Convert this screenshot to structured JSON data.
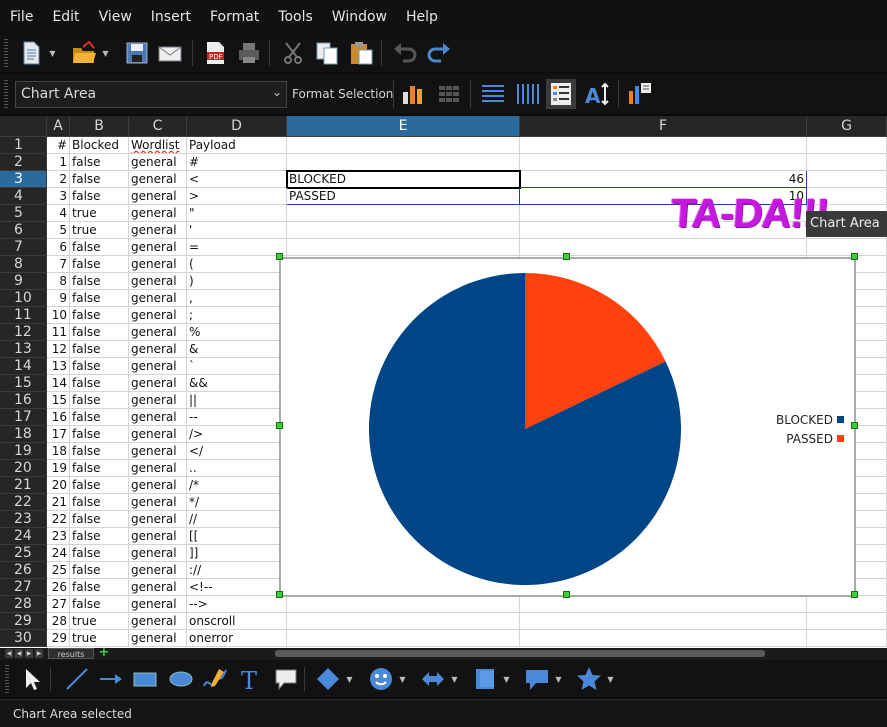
{
  "menubar": {
    "items": [
      "File",
      "Edit",
      "View",
      "Insert",
      "Format",
      "Tools",
      "Window",
      "Help"
    ]
  },
  "toolbar_standard": {
    "buttons": [
      {
        "name": "new-document-icon",
        "dropdown": true
      },
      {
        "name": "open-folder-icon",
        "dropdown": true
      },
      {
        "name": "save-icon"
      },
      {
        "name": "email-icon"
      },
      {
        "name": "export-pdf-icon"
      },
      {
        "name": "print-icon"
      },
      {
        "name": "cut-icon"
      },
      {
        "name": "copy-icon"
      },
      {
        "name": "paste-icon"
      },
      {
        "name": "undo-icon"
      },
      {
        "name": "redo-icon"
      }
    ]
  },
  "toolbar_chart": {
    "element_select": {
      "value": "Chart Area"
    },
    "format_selection_label": "Format Selection",
    "buttons": [
      {
        "name": "chart-type-icon"
      },
      {
        "name": "data-table-icon"
      },
      {
        "name": "horizontal-grids-icon"
      },
      {
        "name": "vertical-grids-icon"
      },
      {
        "name": "legend-on-off-icon"
      },
      {
        "name": "scale-text-icon"
      },
      {
        "name": "automatic-layout-icon"
      }
    ]
  },
  "sheet": {
    "columns": [
      "A",
      "B",
      "C",
      "D",
      "E",
      "F",
      "G"
    ],
    "selected_column": "E",
    "selected_row": "3",
    "header_row": {
      "A": "#",
      "B": "Blocked",
      "C": "Wordlist",
      "D": "Payload"
    },
    "rows": [
      {
        "A": "1",
        "B": "false",
        "C": "general",
        "D": "#"
      },
      {
        "A": "2",
        "B": "false",
        "C": "general",
        "D": "<"
      },
      {
        "A": "3",
        "B": "false",
        "C": "general",
        "D": ">"
      },
      {
        "A": "4",
        "B": "true",
        "C": "general",
        "D": "\""
      },
      {
        "A": "5",
        "B": "true",
        "C": "general",
        "D": "'"
      },
      {
        "A": "6",
        "B": "false",
        "C": "general",
        "D": "="
      },
      {
        "A": "7",
        "B": "false",
        "C": "general",
        "D": "("
      },
      {
        "A": "8",
        "B": "false",
        "C": "general",
        "D": ")"
      },
      {
        "A": "9",
        "B": "false",
        "C": "general",
        "D": ","
      },
      {
        "A": "10",
        "B": "false",
        "C": "general",
        "D": ";"
      },
      {
        "A": "11",
        "B": "false",
        "C": "general",
        "D": "%"
      },
      {
        "A": "12",
        "B": "false",
        "C": "general",
        "D": "&"
      },
      {
        "A": "13",
        "B": "false",
        "C": "general",
        "D": "`"
      },
      {
        "A": "14",
        "B": "false",
        "C": "general",
        "D": "&&"
      },
      {
        "A": "15",
        "B": "false",
        "C": "general",
        "D": "||"
      },
      {
        "A": "16",
        "B": "false",
        "C": "general",
        "D": "--"
      },
      {
        "A": "17",
        "B": "false",
        "C": "general",
        "D": "/>"
      },
      {
        "A": "18",
        "B": "false",
        "C": "general",
        "D": "</"
      },
      {
        "A": "19",
        "B": "false",
        "C": "general",
        "D": ".."
      },
      {
        "A": "20",
        "B": "false",
        "C": "general",
        "D": "/*"
      },
      {
        "A": "21",
        "B": "false",
        "C": "general",
        "D": "*/"
      },
      {
        "A": "22",
        "B": "false",
        "C": "general",
        "D": "//"
      },
      {
        "A": "23",
        "B": "false",
        "C": "general",
        "D": "[["
      },
      {
        "A": "24",
        "B": "false",
        "C": "general",
        "D": "]]"
      },
      {
        "A": "25",
        "B": "false",
        "C": "general",
        "D": "://"
      },
      {
        "A": "26",
        "B": "false",
        "C": "general",
        "D": "<!--"
      },
      {
        "A": "27",
        "B": "false",
        "C": "general",
        "D": "-->"
      },
      {
        "A": "28",
        "B": "true",
        "C": "general",
        "D": "onscroll"
      },
      {
        "A": "29",
        "B": "true",
        "C": "general",
        "D": "onerror"
      }
    ],
    "summary": [
      {
        "label": "BLOCKED",
        "value": "46"
      },
      {
        "label": "PASSED",
        "value": "10"
      }
    ],
    "decoration_text": "TA-DA!!!",
    "tab_name": "results"
  },
  "chart_data": {
    "type": "pie",
    "categories": [
      "BLOCKED",
      "PASSED"
    ],
    "values": [
      46,
      10
    ],
    "colors": [
      "#004586",
      "#ff420e"
    ],
    "legend_position": "right"
  },
  "tooltip": "Chart Area",
  "drawing_toolbar": {
    "tools": [
      "select-icon",
      "line-icon",
      "arrow-icon",
      "rectangle-icon",
      "ellipse-icon",
      "freeform-line-icon",
      "text-icon",
      "callout-icon",
      "basic-shapes-icon",
      "symbol-shapes-icon",
      "block-arrows-icon",
      "flowchart-icon",
      "callouts-icon",
      "stars-icon"
    ]
  },
  "statusbar": {
    "text": "Chart Area selected"
  }
}
